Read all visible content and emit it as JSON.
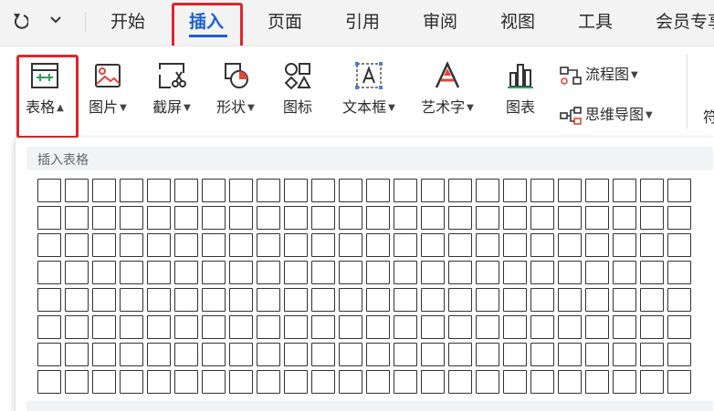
{
  "menubar": {
    "tabs": [
      {
        "label": "开始"
      },
      {
        "label": "插入",
        "active": true
      },
      {
        "label": "页面"
      },
      {
        "label": "引用"
      },
      {
        "label": "审阅"
      },
      {
        "label": "视图"
      },
      {
        "label": "工具"
      },
      {
        "label": "会员专享"
      }
    ]
  },
  "ribbon": {
    "table": {
      "label": "表格"
    },
    "picture": {
      "label": "图片"
    },
    "screenshot": {
      "label": "截屏"
    },
    "shape": {
      "label": "形状"
    },
    "icons": {
      "label": "图标"
    },
    "textbox": {
      "label": "文本框"
    },
    "wordart": {
      "label": "艺术字"
    },
    "chart": {
      "label": "图表"
    },
    "flowchart": {
      "label": "流程图"
    },
    "mindmap": {
      "label": "思维导图"
    },
    "cut_off": "符"
  },
  "panel": {
    "title": "插入表格",
    "grid_cols": 24,
    "grid_rows": 8
  },
  "colors": {
    "accent": "#1b5fd8",
    "highlight": "#e0242b",
    "icon_red": "#e0463c",
    "icon_green": "#2e9e5a"
  },
  "icons": [
    "undo-icon",
    "chevron-down-icon",
    "table-icon",
    "picture-icon",
    "screenshot-icon",
    "shape-icon",
    "icons-icon",
    "textbox-icon",
    "wordart-icon",
    "chart-icon",
    "flowchart-icon",
    "mindmap-icon"
  ]
}
